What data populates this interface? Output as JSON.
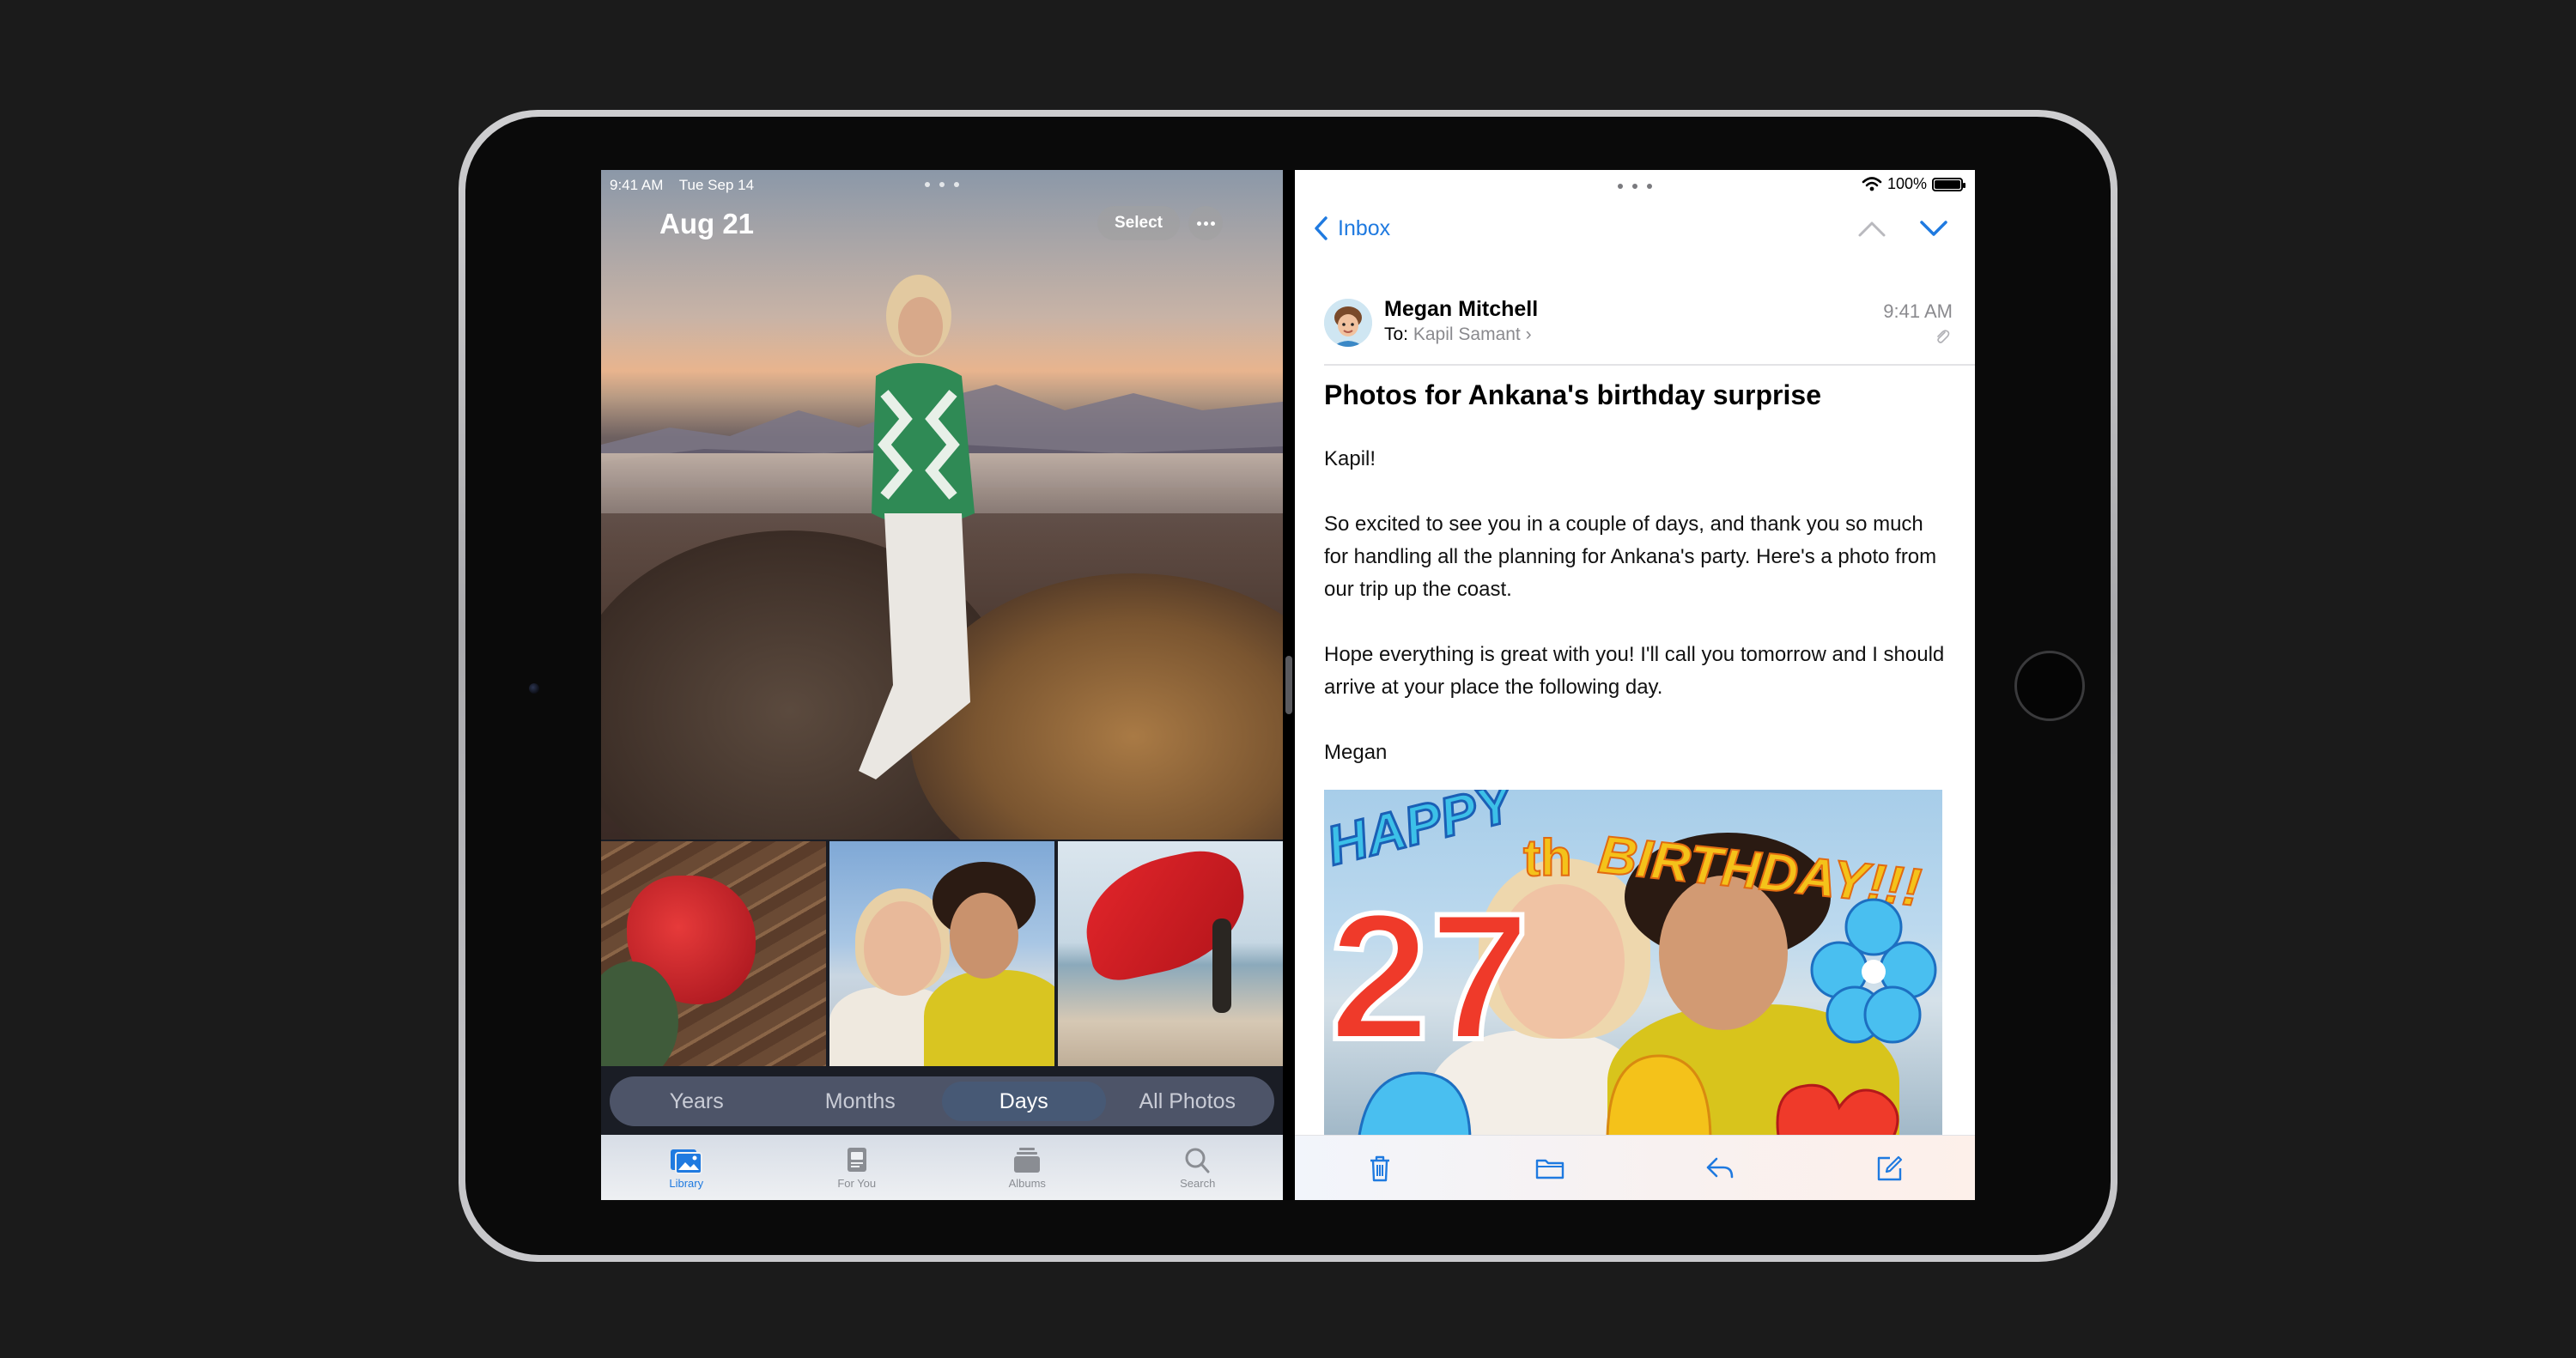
{
  "photos": {
    "status": {
      "time": "9:41 AM",
      "date": "Tue Sep 14"
    },
    "title": "Aug 21",
    "select_label": "Select",
    "more_icon": "ellipsis-icon",
    "segments": [
      {
        "label": "Years",
        "active": false
      },
      {
        "label": "Months",
        "active": false
      },
      {
        "label": "Days",
        "active": true
      },
      {
        "label": "All Photos",
        "active": false
      }
    ],
    "tabs": [
      {
        "label": "Library",
        "icon": "photo-library-icon",
        "active": true
      },
      {
        "label": "For You",
        "icon": "for-you-icon",
        "active": false
      },
      {
        "label": "Albums",
        "icon": "albums-icon",
        "active": false
      },
      {
        "label": "Search",
        "icon": "search-icon",
        "active": false
      }
    ]
  },
  "mail": {
    "status": {
      "battery": "100%"
    },
    "back_label": "Inbox",
    "sender": {
      "name": "Megan Mitchell",
      "to_prefix": "To:",
      "to": "Kapil Samant",
      "time": "9:41 AM"
    },
    "subject": "Photos for Ankana's birthday surprise",
    "body": [
      "Kapil!",
      "So excited to see you in a couple of days, and thank you so much for handling all the planning for Ankana's party. Here's a photo from our trip up the coast.",
      "Hope everything is great with you! I'll call you tomorrow and I should arrive at your place the following day.",
      "Megan"
    ],
    "attachment": {
      "line1": "HAPPY",
      "number": "27",
      "suffix": "th",
      "line2": "BIRTHDAY!!!"
    },
    "toolbar": [
      "trash-icon",
      "folder-icon",
      "reply-icon",
      "compose-icon"
    ]
  },
  "colors": {
    "accent": "#1f7ae0",
    "bezel": "#0a0a0a",
    "frame": "#bdbdc0"
  }
}
